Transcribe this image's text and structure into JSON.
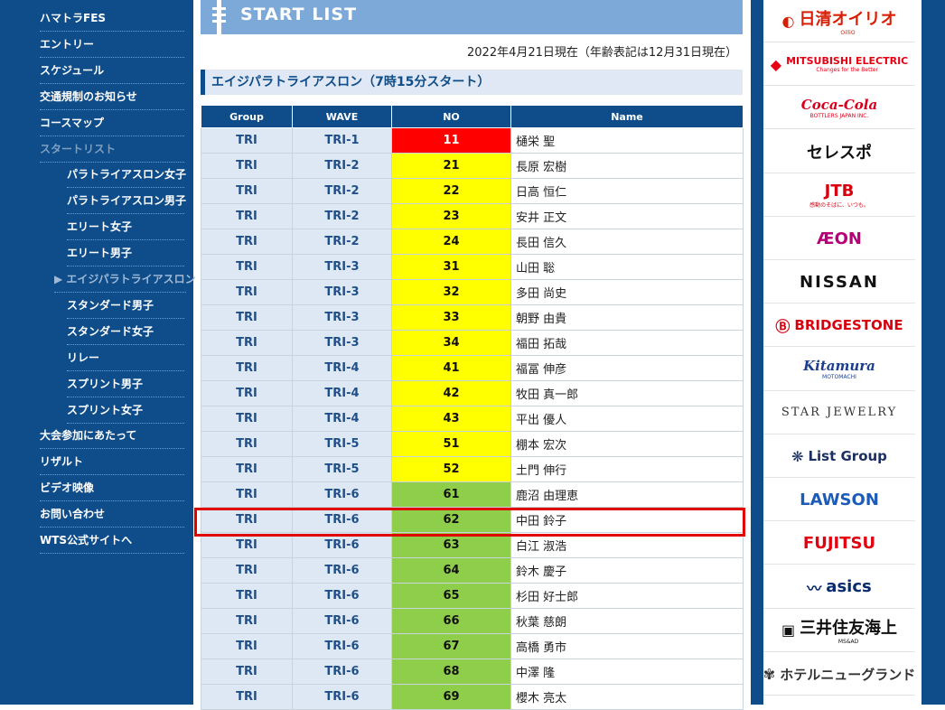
{
  "nav": {
    "items": [
      {
        "label": "ハマトラFES",
        "sub": false,
        "state": ""
      },
      {
        "label": "エントリー",
        "sub": false,
        "state": ""
      },
      {
        "label": "スケジュール",
        "sub": false,
        "state": ""
      },
      {
        "label": "交通規制のお知らせ",
        "sub": false,
        "state": ""
      },
      {
        "label": "コースマップ",
        "sub": false,
        "state": ""
      },
      {
        "label": "スタートリスト",
        "sub": false,
        "state": "current"
      },
      {
        "label": "パラトライアスロン女子",
        "sub": true,
        "state": ""
      },
      {
        "label": "パラトライアスロン男子",
        "sub": true,
        "state": ""
      },
      {
        "label": "エリート女子",
        "sub": true,
        "state": ""
      },
      {
        "label": "エリート男子",
        "sub": true,
        "state": ""
      },
      {
        "label": "▶ エイジパラトライアスロン",
        "sub": true,
        "state": "active"
      },
      {
        "label": "スタンダード男子",
        "sub": true,
        "state": ""
      },
      {
        "label": "スタンダード女子",
        "sub": true,
        "state": ""
      },
      {
        "label": "リレー",
        "sub": true,
        "state": ""
      },
      {
        "label": "スプリント男子",
        "sub": true,
        "state": ""
      },
      {
        "label": "スプリント女子",
        "sub": true,
        "state": ""
      },
      {
        "label": "大会参加にあたって",
        "sub": false,
        "state": ""
      },
      {
        "label": "リザルト",
        "sub": false,
        "state": ""
      },
      {
        "label": "ビデオ映像",
        "sub": false,
        "state": ""
      },
      {
        "label": "お問い合わせ",
        "sub": false,
        "state": ""
      },
      {
        "label": "WTS公式サイトへ",
        "sub": false,
        "state": ""
      }
    ]
  },
  "banner": {
    "title": "START LIST"
  },
  "as_of": "2022年4月21日現在（年齢表記は12月31日現在）",
  "section_title": "エイジパラトライアスロン（7時15分スタート）",
  "table": {
    "headers": [
      "Group",
      "WAVE",
      "NO",
      "Name"
    ],
    "rows": [
      {
        "group": "TRI",
        "wave": "TRI-1",
        "no": "11",
        "name": "樋栄 聖",
        "color": "red"
      },
      {
        "group": "TRI",
        "wave": "TRI-2",
        "no": "21",
        "name": "長原 宏樹",
        "color": "yellow"
      },
      {
        "group": "TRI",
        "wave": "TRI-2",
        "no": "22",
        "name": "日高 恒仁",
        "color": "yellow"
      },
      {
        "group": "TRI",
        "wave": "TRI-2",
        "no": "23",
        "name": "安井 正文",
        "color": "yellow"
      },
      {
        "group": "TRI",
        "wave": "TRI-2",
        "no": "24",
        "name": "長田 信久",
        "color": "yellow"
      },
      {
        "group": "TRI",
        "wave": "TRI-3",
        "no": "31",
        "name": "山田 聡",
        "color": "yellow"
      },
      {
        "group": "TRI",
        "wave": "TRI-3",
        "no": "32",
        "name": "多田 尚史",
        "color": "yellow"
      },
      {
        "group": "TRI",
        "wave": "TRI-3",
        "no": "33",
        "name": "朝野 由貴",
        "color": "yellow"
      },
      {
        "group": "TRI",
        "wave": "TRI-3",
        "no": "34",
        "name": "福田 拓哉",
        "color": "yellow"
      },
      {
        "group": "TRI",
        "wave": "TRI-4",
        "no": "41",
        "name": "福冨 伸彦",
        "color": "yellow"
      },
      {
        "group": "TRI",
        "wave": "TRI-4",
        "no": "42",
        "name": "牧田 真一郎",
        "color": "yellow"
      },
      {
        "group": "TRI",
        "wave": "TRI-4",
        "no": "43",
        "name": "平出 優人",
        "color": "yellow"
      },
      {
        "group": "TRI",
        "wave": "TRI-5",
        "no": "51",
        "name": "棚本 宏次",
        "color": "yellow"
      },
      {
        "group": "TRI",
        "wave": "TRI-5",
        "no": "52",
        "name": "土門 伸行",
        "color": "yellow"
      },
      {
        "group": "TRI",
        "wave": "TRI-6",
        "no": "61",
        "name": "鹿沼 由理恵",
        "color": "green"
      },
      {
        "group": "TRI",
        "wave": "TRI-6",
        "no": "62",
        "name": "中田 鈴子",
        "color": "green"
      },
      {
        "group": "TRI",
        "wave": "TRI-6",
        "no": "63",
        "name": "白江 淑浩",
        "color": "green"
      },
      {
        "group": "TRI",
        "wave": "TRI-6",
        "no": "64",
        "name": "鈴木 慶子",
        "color": "green"
      },
      {
        "group": "TRI",
        "wave": "TRI-6",
        "no": "65",
        "name": "杉田 好士郎",
        "color": "green"
      },
      {
        "group": "TRI",
        "wave": "TRI-6",
        "no": "66",
        "name": "秋葉 慈朗",
        "color": "green"
      },
      {
        "group": "TRI",
        "wave": "TRI-6",
        "no": "67",
        "name": "高橋 勇市",
        "color": "green"
      },
      {
        "group": "TRI",
        "wave": "TRI-6",
        "no": "68",
        "name": "中澤 隆",
        "color": "green"
      },
      {
        "group": "TRI",
        "wave": "TRI-6",
        "no": "69",
        "name": "櫻木 亮太",
        "color": "green"
      }
    ]
  },
  "sponsors": [
    {
      "text": "日清オイリオ",
      "icon": "oillio-logo-icon",
      "color": "#d81e05",
      "small": "OilliO"
    },
    {
      "text": "MITSUBISHI ELECTRIC",
      "icon": "mitsubishi-diamonds-icon",
      "color": "#e60012",
      "small": "Changes for the Better"
    },
    {
      "text": "Coca-Cola",
      "icon": "",
      "color": "#d8001c",
      "small": "BOTTLERS JAPAN INC."
    },
    {
      "text": "セレスポ",
      "icon": "",
      "color": "#111111",
      "small": ""
    },
    {
      "text": "JTB",
      "icon": "",
      "color": "#d7000f",
      "small": "感動のそばに、いつも。"
    },
    {
      "text": "ÆON",
      "icon": "",
      "color": "#b6007a",
      "small": ""
    },
    {
      "text": "NISSAN",
      "icon": "",
      "color": "#111111",
      "small": ""
    },
    {
      "text": "BRIDGESTONE",
      "icon": "bridgestone-b-icon",
      "color": "#d7000f",
      "small": ""
    },
    {
      "text": "Kitamura",
      "icon": "",
      "color": "#1b3f8f",
      "small": "MOTOMACHI"
    },
    {
      "text": "STAR JEWELRY",
      "icon": "",
      "color": "#333333",
      "small": ""
    },
    {
      "text": "List Group",
      "icon": "list-group-mark-icon",
      "color": "#1b3060",
      "small": ""
    },
    {
      "text": "LAWSON",
      "icon": "",
      "color": "#1d5bb8",
      "small": ""
    },
    {
      "text": "FUJITSU",
      "icon": "",
      "color": "#e3000f",
      "small": ""
    },
    {
      "text": "asics",
      "icon": "asics-stripe-icon",
      "color": "#0a2a6e",
      "small": ""
    },
    {
      "text": "三井住友海上",
      "icon": "msad-badge-icon",
      "color": "#111111",
      "small": "MS&AD"
    },
    {
      "text": "ホテルニューグランド",
      "icon": "hotel-crest-icon",
      "color": "#333333",
      "small": ""
    }
  ]
}
